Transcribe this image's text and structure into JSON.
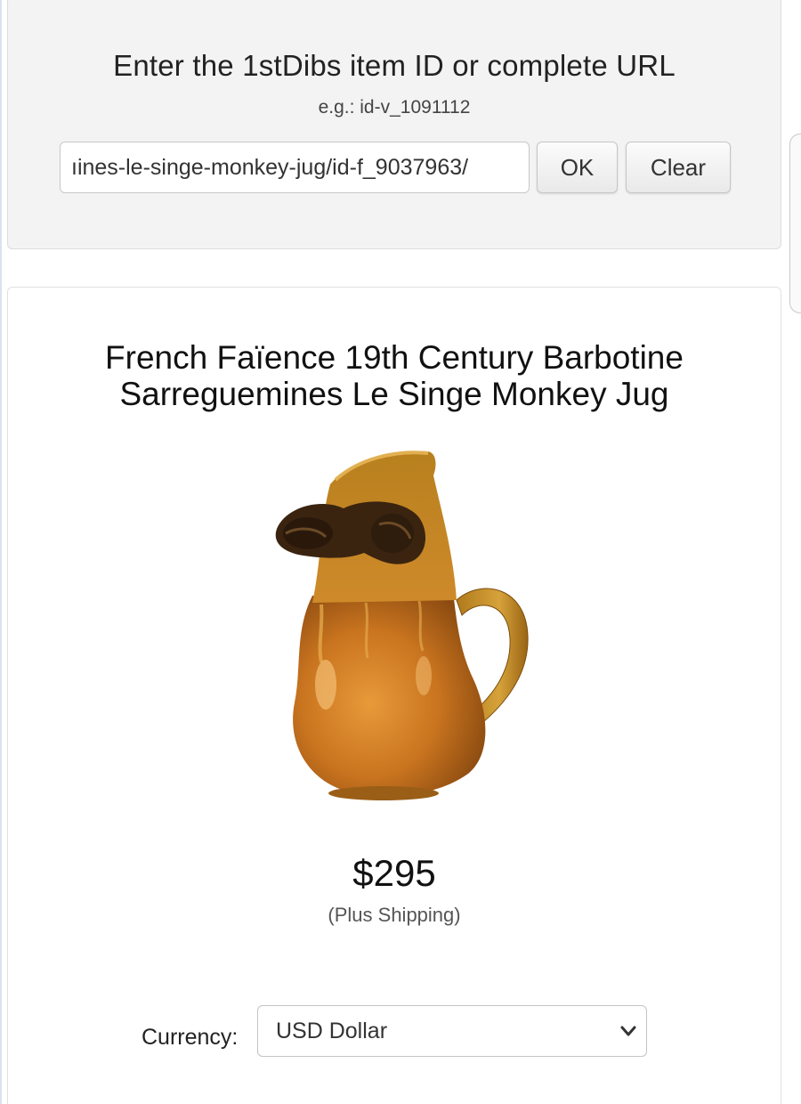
{
  "search": {
    "title": "Enter the 1stDibs item ID or complete URL",
    "example": "e.g.: id-v_1091112",
    "input_value": "ıines-le-singe-monkey-jug/id-f_9037963/",
    "ok_label": "OK",
    "clear_label": "Clear"
  },
  "item": {
    "title": "French Faïence 19th Century Barbotine Sarreguemines Le Singe Monkey Jug",
    "image_icon": "monkey-jug-image",
    "price": "$295",
    "shipping_note": "(Plus Shipping)"
  },
  "currency": {
    "label": "Currency:",
    "selected": "USD Dollar",
    "chevron_icon": "chevron-down-icon"
  }
}
